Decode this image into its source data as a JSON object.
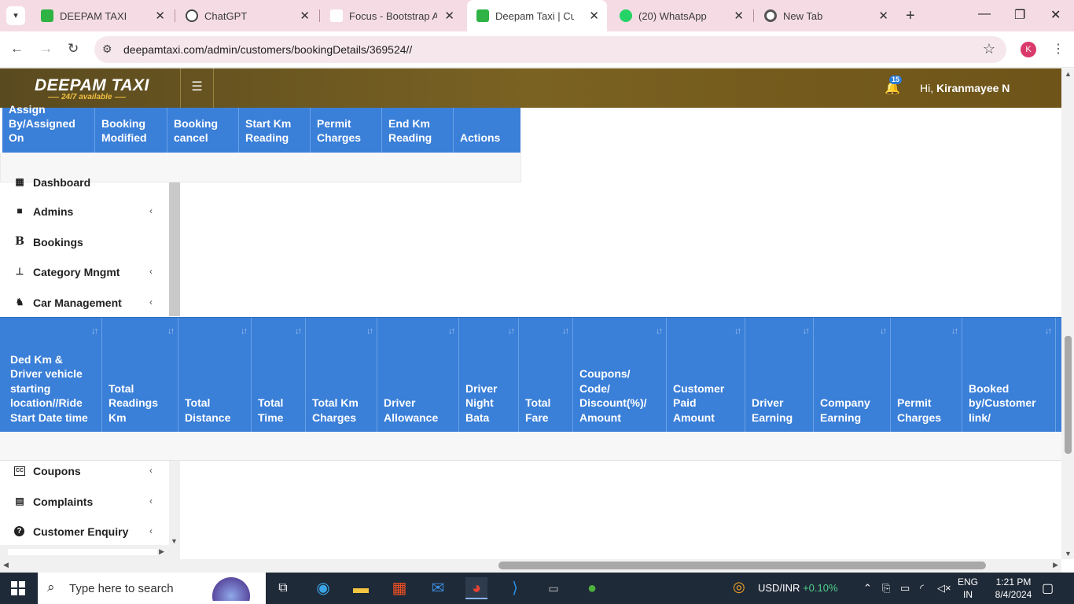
{
  "browser": {
    "tabs": [
      {
        "title": "DEEPAM TAXI",
        "close": "✕",
        "fav_color": "#2fb344",
        "fav_glyph": "D"
      },
      {
        "title": "ChatGPT",
        "close": "✕",
        "fav_color": "#444",
        "fav_glyph": "✿"
      },
      {
        "title": "Focus - Bootstrap Ad",
        "close": "✕",
        "fav_color": "#fff",
        "fav_glyph": ""
      },
      {
        "title": "Deepam Taxi | Custo",
        "close": "✕",
        "fav_color": "#2fb344",
        "fav_glyph": "D"
      },
      {
        "title": "(20) WhatsApp",
        "close": "✕",
        "fav_color": "#25d366",
        "fav_glyph": "✆"
      },
      {
        "title": "New Tab",
        "close": "✕",
        "fav_color": "#555",
        "fav_glyph": "◉"
      }
    ],
    "url": "deepamtaxi.com/admin/customers/bookingDetails/369524//",
    "profile_initial": "K"
  },
  "header": {
    "brand": "DEEPAM TAXI",
    "tagline": "24/7 available",
    "notification_count": "15",
    "greeting_prefix": "Hi,",
    "user_name": "Kiranmayee N"
  },
  "top_table": {
    "columns": [
      "Assign By/Assigned On",
      "Booking Modified",
      "Booking cancel",
      "Start Km Reading",
      "Permit Charges",
      "End Km Reading",
      "Actions"
    ]
  },
  "sidebar_top": [
    {
      "label": "Dashboard",
      "icon": "dashboard-icon",
      "glyph": "▦",
      "chevron": ""
    },
    {
      "label": "Admins",
      "icon": "lock-icon",
      "glyph": "🔒",
      "chevron": "‹"
    },
    {
      "label": "Bookings",
      "icon": "bold-b-icon",
      "glyph": "B",
      "chevron": ""
    },
    {
      "label": "Category Mngmt",
      "icon": "sitemap-icon",
      "glyph": "⛶",
      "chevron": "‹"
    },
    {
      "label": "Car Management",
      "icon": "driver-icon",
      "glyph": "♞",
      "chevron": "‹"
    }
  ],
  "main_table": {
    "columns": [
      "Ded Km & Driver vehicle starting location//Ride Start Date time",
      "Total Readings Km",
      "Total Distance",
      "Total Time",
      "Total Km Charges",
      "Driver Allowance",
      "Driver Night Bata",
      "Total Fare",
      "Coupons/ Code/ Discount(%)/ Amount",
      "Customer Paid Amount",
      "Driver Earning",
      "Company Earning",
      "Permit Charges",
      "Booked by/Customer link/"
    ],
    "sort_glyph": "↓↑"
  },
  "sidebar_bottom": [
    {
      "label": "Coupons",
      "icon": "cc-icon",
      "glyph": "㏄",
      "chevron": "‹"
    },
    {
      "label": "Complaints",
      "icon": "document-icon",
      "glyph": "▤",
      "chevron": "‹"
    },
    {
      "label": "Customer Enquiry",
      "icon": "question-icon",
      "glyph": "?",
      "chevron": "‹"
    }
  ],
  "taskbar": {
    "search_placeholder": "Type here to search",
    "ticker_label": "USD/INR",
    "ticker_change": "+0.10%",
    "lang_line1": "ENG",
    "lang_line2": "IN",
    "time": "1:21 PM",
    "date": "8/4/2024"
  },
  "colors": {
    "header_gold": "#7a6222",
    "table_blue": "#3a7fd8",
    "tab_strip": "#f5dce4"
  }
}
